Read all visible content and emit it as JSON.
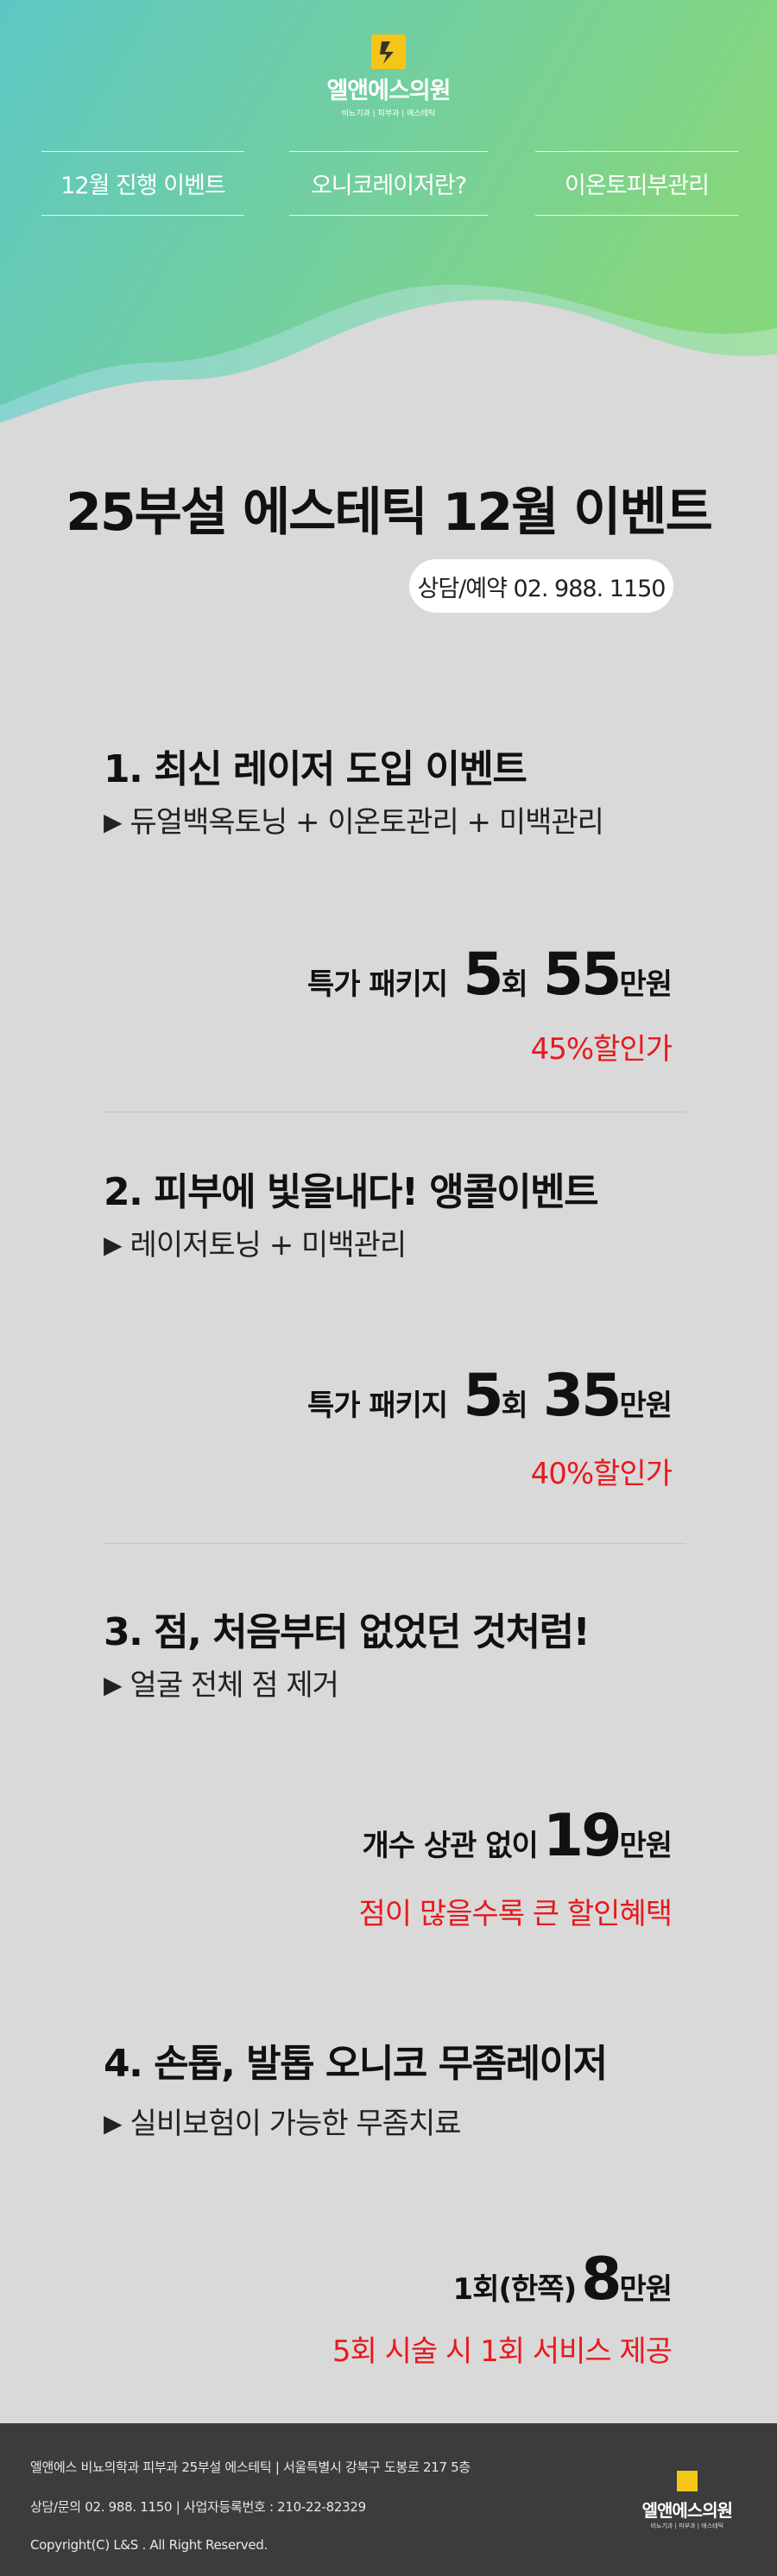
{
  "brand": {
    "name": "엘앤에스의원",
    "subtitle": "비뇨기과 | 피부과 | 에스테틱",
    "colors": {
      "gradient_start": "#5dc7c4",
      "gradient_end": "#86d67e",
      "accent_red": "#e8191d",
      "logo_yellow": "#f5c518"
    }
  },
  "nav": {
    "items": [
      {
        "label": "12월 진행 이벤트"
      },
      {
        "label": "오니코레이저란?"
      },
      {
        "label": "이온토피부관리"
      }
    ]
  },
  "page": {
    "title": "25부설 에스테틱 12월 이벤트",
    "contact": "상담/예약 02. 988. 1150"
  },
  "events": [
    {
      "title": "1. 최신 레이저 도입 이벤트",
      "desc_marker": "▶",
      "desc": "듀얼백옥토닝 + 이온토관리 + 미백관리",
      "price_label": "특가 패키지",
      "sessions": "5",
      "sessions_unit": "회",
      "price": "55",
      "price_unit": "만원",
      "note": "45%할인가"
    },
    {
      "title": "2. 피부에 빛을내다! 앵콜이벤트",
      "desc_marker": "▶",
      "desc": "레이저토닝 + 미백관리",
      "price_label": "특가 패키지",
      "sessions": "5",
      "sessions_unit": "회",
      "price": "35",
      "price_unit": "만원",
      "note": "40%할인가"
    },
    {
      "title": "3. 점, 처음부터 없었던 것처럼!",
      "desc_marker": "▶",
      "desc": "얼굴 전체 점 제거",
      "price_label": "개수 상관 없이",
      "price": "19",
      "price_unit": "만원",
      "note": "점이 많을수록 큰 할인혜택"
    },
    {
      "title": "4. 손톱, 발톱 오니코 무좀레이저",
      "desc_marker": "▶",
      "desc": "실비보험이 가능한 무좀치료",
      "price_label": "1회(한쪽)",
      "price": "8",
      "price_unit": "만원",
      "note": "5회 시술 시 1회 서비스 제공"
    }
  ],
  "footer": {
    "line1": "엘앤에스 비뇨의학과 피부과 25부설 에스테틱  |  서울특별시 강북구 도봉로 217 5층",
    "line2": "상담/문의 02. 988. 1150  |  사업자등록번호 : 210-22-82329",
    "line3": "Copyright(C) L&S . All Right Reserved.",
    "logo_name": "엘앤에스의원",
    "logo_sub": "비뇨기과 | 피부과 | 에스테틱"
  }
}
